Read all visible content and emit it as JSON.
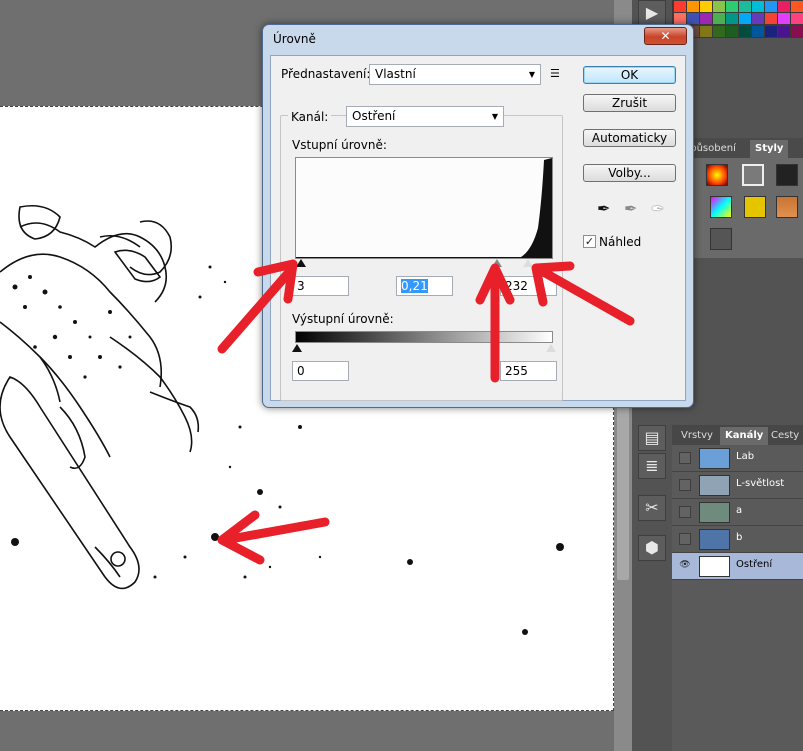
{
  "dialog": {
    "title": "Úrovně",
    "close": "✕",
    "preset_label": "Přednastavení:",
    "preset_value": "Vlastní",
    "channel_label": "Kanál:",
    "channel_value": "Ostření",
    "input_levels_label": "Vstupní úrovně:",
    "input_black": "3",
    "input_gamma": "0,21",
    "input_white": "232",
    "output_levels_label": "Výstupní úrovně:",
    "output_black": "0",
    "output_white": "255",
    "buttons": {
      "ok": "OK",
      "cancel": "Zrušit",
      "auto": "Automaticky",
      "options": "Volby..."
    },
    "preview_label": "Náhled",
    "preview_checked": "✓"
  },
  "panels": {
    "styles_tabs": [
      "způsobení",
      "Styly"
    ],
    "layers_tabs": [
      "Vrstvy",
      "Kanály",
      "Cesty"
    ],
    "channels": [
      {
        "name": "Lab",
        "thumb_color": "#6a9fd8"
      },
      {
        "name": "L-světlost",
        "thumb_color": "#8fa3b5"
      },
      {
        "name": "a",
        "thumb_color": "#6e8b7e"
      },
      {
        "name": "b",
        "thumb_color": "#4f74a8"
      },
      {
        "name": "Ostření",
        "thumb_color": "#ffffff"
      }
    ],
    "eye_visible": "👁"
  },
  "dock": {
    "icons": [
      "play-icon",
      "notes-icon",
      "doc-icon",
      "tools-icon",
      "cube-icon"
    ],
    "play": "▶",
    "notes": "▤",
    "doc": "≣",
    "tools": "✂",
    "cube": "⬢"
  },
  "colors": {
    "arrow": "#e8202a",
    "dialog_frame": "#c9d9ec",
    "selection_blue": "#3399ff"
  }
}
